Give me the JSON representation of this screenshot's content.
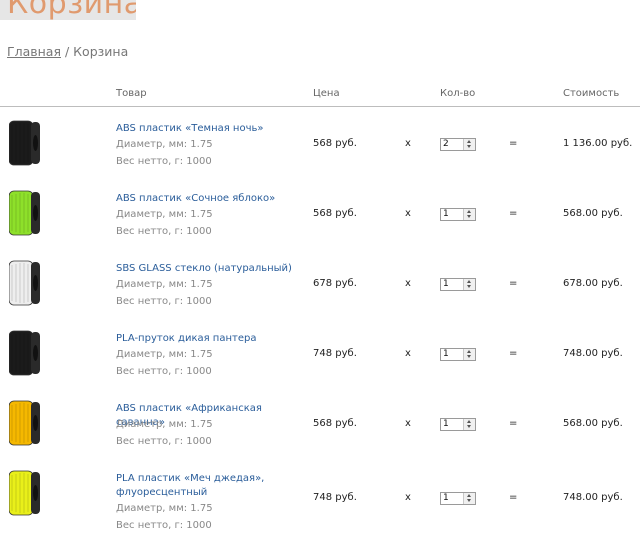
{
  "header": {
    "logo_text": "Корзина"
  },
  "breadcrumb": {
    "home": "Главная",
    "separator": " / ",
    "current": "Корзина"
  },
  "columns": {
    "product": "Товар",
    "price": "Цена",
    "qty": "Кол-во",
    "cost": "Стоимость"
  },
  "symbols": {
    "times": "x",
    "equals": "="
  },
  "colors": {
    "link": "#2a5d9a",
    "logo": "#e09a6e"
  },
  "items": [
    {
      "name": "ABS пластик «Темная ночь»",
      "diameter": "Диаметр, мм: 1.75",
      "weight": "Вес нетто, г: 1000",
      "price": "568 руб.",
      "qty": "2",
      "cost": "1 136.00 руб.",
      "spool_color": "#1b1b1b"
    },
    {
      "name": "ABS пластик «Сочное яблоко»",
      "diameter": "Диаметр, мм: 1.75",
      "weight": "Вес нетто, г: 1000",
      "price": "568 руб.",
      "qty": "1",
      "cost": "568.00 руб.",
      "spool_color": "#8ee02a"
    },
    {
      "name": "SBS GLASS стекло (натуральный)",
      "diameter": "Диаметр, мм: 1.75",
      "weight": "Вес нетто, г: 1000",
      "price": "678 руб.",
      "qty": "1",
      "cost": "678.00 руб.",
      "spool_color": "#eeeeee"
    },
    {
      "name": "PLA-пруток дикая пантера",
      "diameter": "Диаметр, мм: 1.75",
      "weight": "Вес нетто, г: 1000",
      "price": "748 руб.",
      "qty": "1",
      "cost": "748.00 руб.",
      "spool_color": "#1b1b1b"
    },
    {
      "name": "ABS пластик «Африканская саванна»",
      "diameter": "Диаметр, мм: 1.75",
      "weight": "Вес нетто, г: 1000",
      "price": "568 руб.",
      "qty": "1",
      "cost": "568.00 руб.",
      "spool_color": "#f5b800"
    },
    {
      "name": "PLA пластик «Меч джедая», флуоресцентный",
      "diameter": "Диаметр, мм: 1.75",
      "weight": "Вес нетто, г: 1000",
      "price": "748 руб.",
      "qty": "1",
      "cost": "748.00 руб.",
      "spool_color": "#e9ef1a"
    }
  ]
}
